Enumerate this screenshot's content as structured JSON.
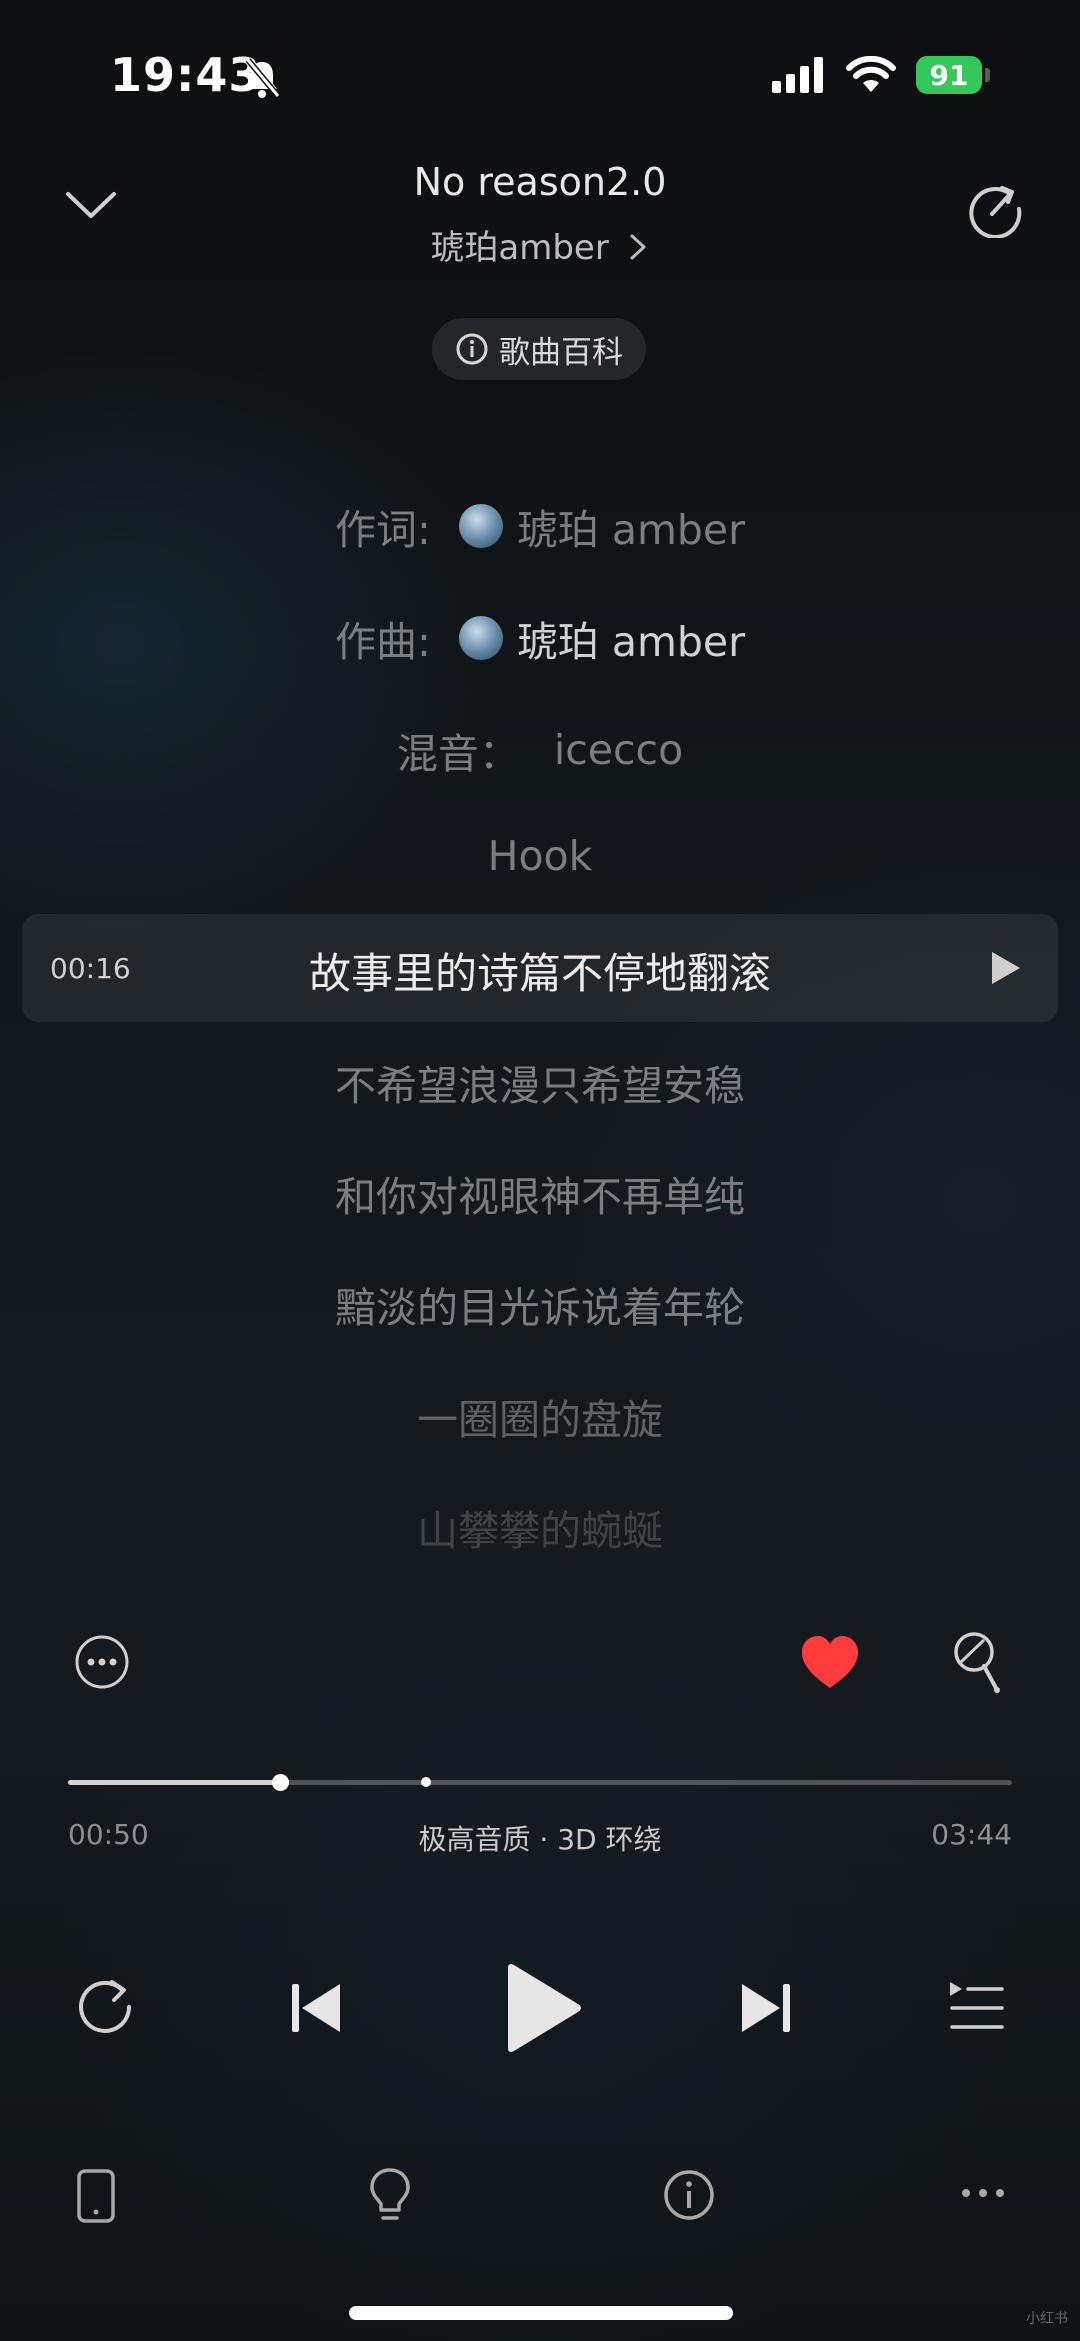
{
  "status_bar": {
    "time": "19:43",
    "battery": "91"
  },
  "header": {
    "title": "No reason2.0",
    "artist": "琥珀amber",
    "wiki_label": "歌曲百科"
  },
  "lyrics": {
    "credits": [
      {
        "label": "作词:",
        "value": "琥珀 amber"
      },
      {
        "label": "作曲:",
        "value": "琥珀 amber"
      },
      {
        "label": "混音：",
        "value": "icecco"
      }
    ],
    "lines": [
      "Hook",
      "故事里的诗篇不停地翻滚",
      "不希望浪漫只希望安稳",
      "和你对视眼神不再单纯",
      "黯淡的目光诉说着年轮",
      "一圈圈的盘旋",
      "山攀攀的蜿蜒"
    ],
    "active_time": "00:16"
  },
  "player": {
    "current_time": "00:50",
    "total_time": "03:44",
    "quality": "极高音质 · 3D 环绕",
    "progress_fraction": 0.228,
    "liked": true,
    "accent_color": "#ff3b3b"
  },
  "watermark": "小红书"
}
